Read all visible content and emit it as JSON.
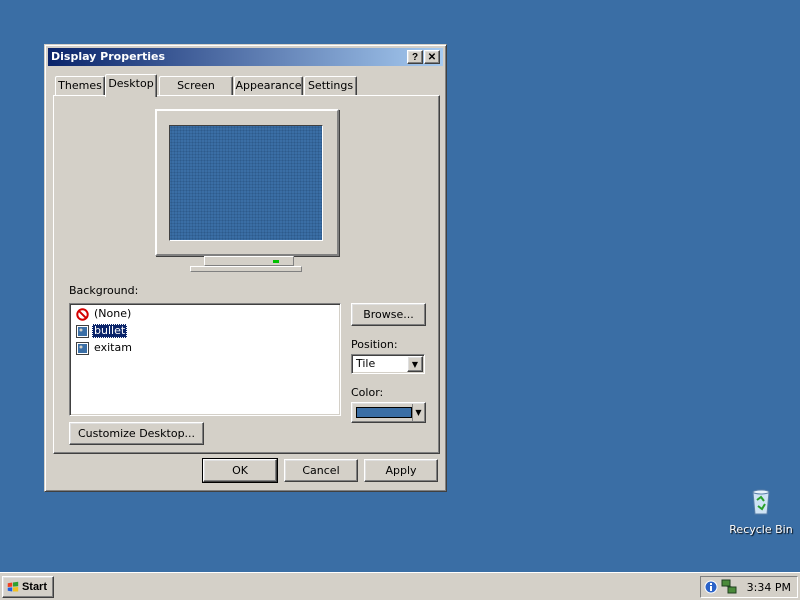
{
  "window": {
    "title": "Display Properties",
    "help_label": "?",
    "close_label": "✕"
  },
  "tabs": [
    {
      "label": "Themes"
    },
    {
      "label": "Desktop",
      "active": true
    },
    {
      "label": "Screen Saver"
    },
    {
      "label": "Appearance"
    },
    {
      "label": "Settings"
    }
  ],
  "desktop_tab": {
    "background_label": "Background:",
    "backgrounds": [
      {
        "label": "(None)",
        "icon": "none-icon"
      },
      {
        "label": "bullet",
        "icon": "image-icon",
        "selected": true
      },
      {
        "label": "exitam",
        "icon": "image-icon"
      }
    ],
    "browse_label": "Browse...",
    "position_label": "Position:",
    "position_value": "Tile",
    "color_label": "Color:",
    "color_value": "#3a6ea5",
    "customize_label": "Customize Desktop..."
  },
  "buttons": {
    "ok": "OK",
    "cancel": "Cancel",
    "apply": "Apply"
  },
  "desktop": {
    "background_color": "#3a6ea5",
    "recycle_bin_label": "Recycle Bin"
  },
  "taskbar": {
    "start_label": "Start",
    "clock": "3:34 PM"
  }
}
